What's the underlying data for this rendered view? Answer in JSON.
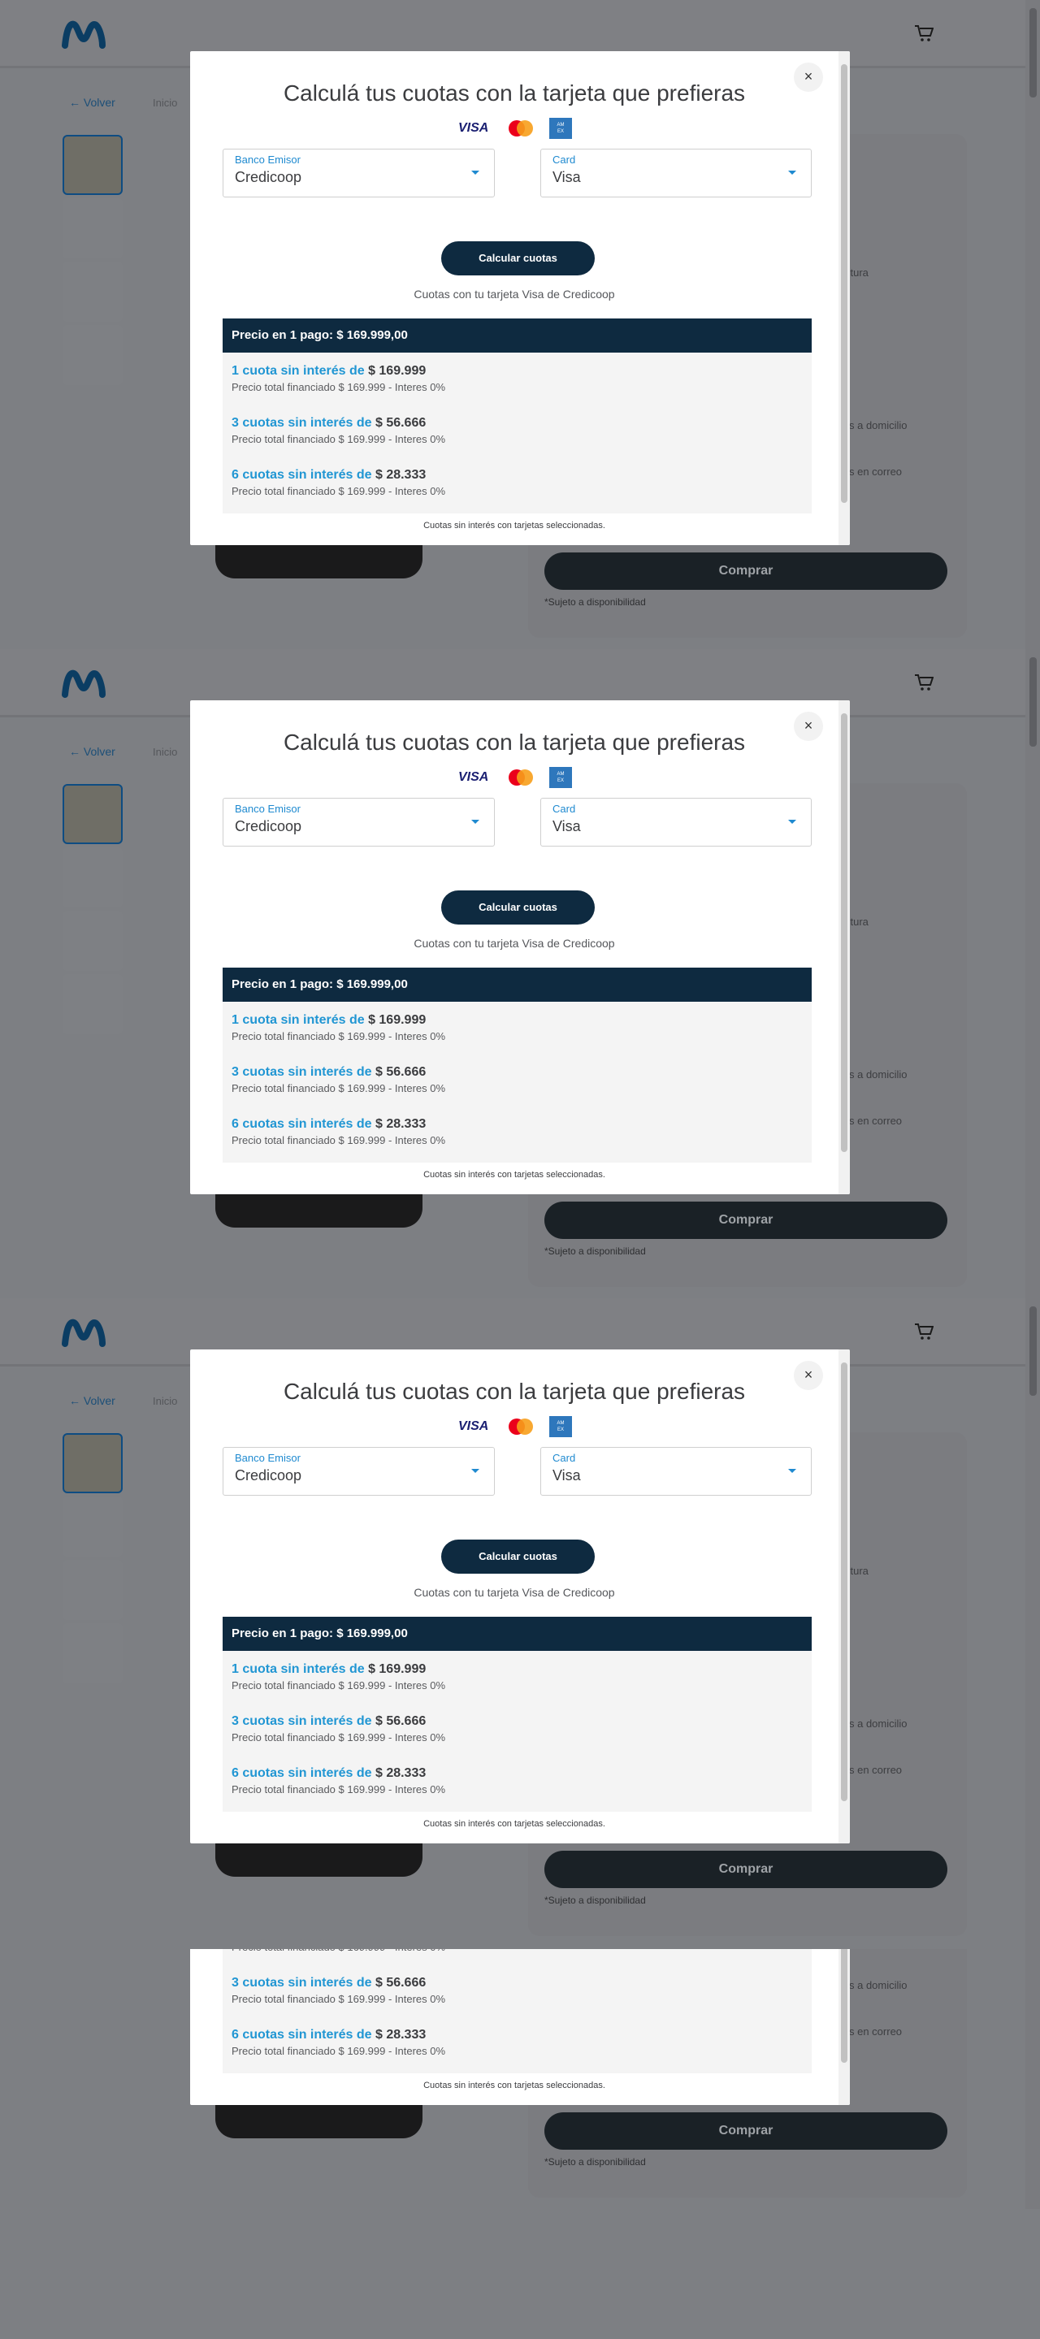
{
  "brand": {
    "logo": "movistar-logo",
    "accent": "#1f8ad0"
  },
  "header": {
    "cart_icon": "cart-icon"
  },
  "nav": {
    "back_label": "← Volver",
    "breadcrumb": "Inicio"
  },
  "product_panel": {
    "field_fragment": "ctura",
    "shipping_home": "s a domicilio",
    "shipping_mail": "s en correo",
    "buy_label": "Comprar",
    "availability_note": "*Sujeto a disponibilidad"
  },
  "modal": {
    "title": "Calculá tus cuotas con la tarjeta que prefieras",
    "close_label": "×",
    "cards": [
      "VISA",
      "mastercard",
      "AMERICAN EXPRESS"
    ],
    "bank": {
      "label": "Banco Emisor",
      "value": "Credicoop"
    },
    "card": {
      "label": "Card",
      "value": "Visa"
    },
    "calc_button": "Calcular cuotas",
    "caption": "Cuotas con tu tarjeta Visa de Credicoop",
    "table_header": "Precio en 1 pago: $ 169.999,00",
    "rows": [
      {
        "title": "1 cuota sin interés de",
        "amount": "$ 169.999",
        "detail": "Precio total financiado $ 169.999 - Interes 0%"
      },
      {
        "title": "3 cuotas sin interés de",
        "amount": "$ 56.666",
        "detail": "Precio total financiado $ 169.999 - Interes 0%"
      },
      {
        "title": "6 cuotas sin interés de",
        "amount": "$ 28.333",
        "detail": "Precio total financiado $ 169.999 - Interes 0%"
      }
    ],
    "footnote": "Cuotas sin interés con tarjetas seleccionadas."
  }
}
